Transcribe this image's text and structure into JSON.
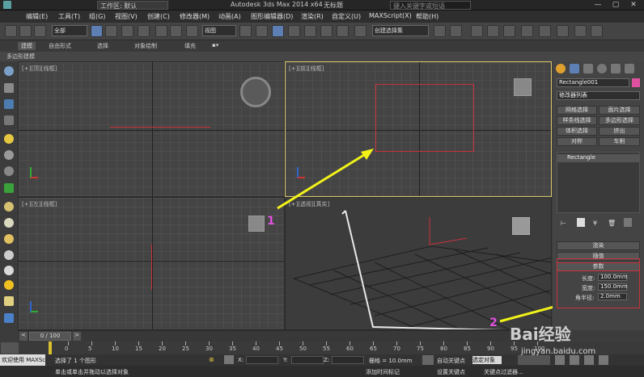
{
  "titlebar": {
    "workspace": "工作区: 默认",
    "app_title": "Autodesk 3ds Max  2014 x64",
    "doc_title": "无标题",
    "search_placeholder": "键入关键字或短语"
  },
  "menu": [
    "编辑(E)",
    "工具(T)",
    "组(G)",
    "视图(V)",
    "创建(C)",
    "修改器(M)",
    "动画(A)",
    "图形编辑器(D)",
    "渲染(R)",
    "自定义(U)",
    "MAXScript(X)",
    "帮助(H)"
  ],
  "toolbar": {
    "filter_select": "全部",
    "ref_coord_select": "视图",
    "selection_set": "创建选择集"
  },
  "ribbon": {
    "tabs": [
      "建模",
      "自由形式",
      "选择",
      "对象绘制",
      "填充"
    ],
    "sub_label": "多边形建模"
  },
  "viewports": {
    "top_left": "[+][顶][线框]",
    "top_right": "[+][前][线框]",
    "bottom_left": "[+][左][线框]",
    "bottom_right": "[+][透视][真实]"
  },
  "panel": {
    "object_name": "Rectangle001",
    "modifier_list": "修改器列表",
    "buttons": [
      "网格选择",
      "面片选择",
      "样条线选择",
      "多边形选择",
      "体积选择",
      "挤出",
      "对称",
      "车削"
    ],
    "stack_item": "Rectangle",
    "rollouts": [
      "渲染",
      "插值",
      "参数"
    ],
    "params": [
      {
        "label": "长度:",
        "value": "100.0mm"
      },
      {
        "label": "宽度:",
        "value": "150.0mm"
      },
      {
        "label": "角半径:",
        "value": "2.0mm"
      }
    ]
  },
  "timeline": {
    "frame": "0 / 100",
    "ticks": [
      "0",
      "5",
      "10",
      "15",
      "20",
      "25",
      "30",
      "35",
      "40",
      "45",
      "50",
      "55",
      "60",
      "65",
      "70",
      "75",
      "80",
      "85",
      "90",
      "95",
      "100"
    ]
  },
  "status": {
    "maxscript": "欢迎使用 MAXSc",
    "selected": "选择了 1 个图形",
    "hint": "单击或单击并拖动以选择对象",
    "x_label": "X:",
    "y_label": "Y:",
    "z_label": "Z:",
    "grid": "栅格 = 10.0mm",
    "auto_key": "自动关键点",
    "set_key": "设置关键点",
    "selected_obj": "选定对象",
    "key_filters": "关键点过滤器...",
    "add_time_tag": "添加时间标记"
  },
  "annotations": {
    "label1": "1",
    "label2": "2",
    "arrow_color": "#f2f21a"
  },
  "watermark": {
    "text": "Bai经验",
    "url": "jingyan.baidu.com"
  },
  "colors": {
    "shape_red": "#c8323c",
    "active_border": "#d8c66a",
    "annotation_magenta": "#e050e0"
  }
}
